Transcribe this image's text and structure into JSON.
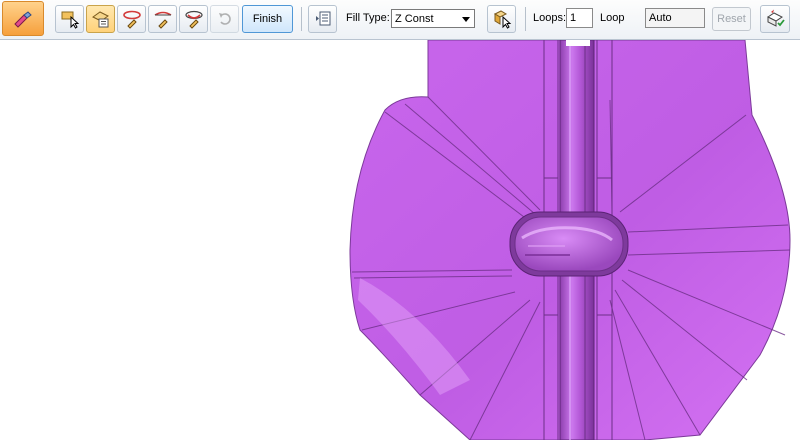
{
  "toolbar": {
    "finish_label": "Finish",
    "fill_type_label": "Fill Type:",
    "fill_type_value": "Z Const",
    "loops_label": "Loops:",
    "loops_value": "1",
    "loop_label": "Loop",
    "loop_value": "Auto",
    "reset_label": "Reset"
  },
  "icons": {
    "mode": "pen-tool-icon",
    "select": "select-cursor-icon",
    "face": "face-select-icon",
    "p1": "pipe-pen-icon",
    "p2": "pipe-pen-2-icon",
    "p3": "pipe-pen-3-icon",
    "undo": "undo-icon",
    "list": "list-icon",
    "cursor": "object-cursor-icon",
    "last": "apply-icon"
  },
  "colors": {
    "model": "#c25ee6",
    "edge": "#6c2f87",
    "accent": "#f6a03c"
  }
}
